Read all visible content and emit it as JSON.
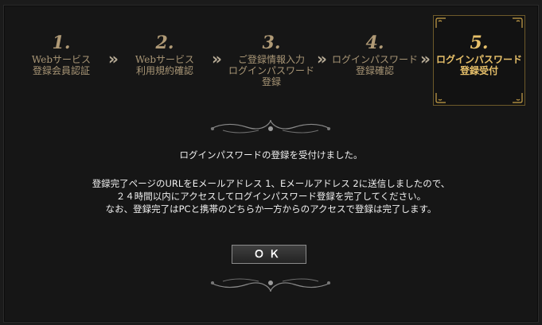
{
  "steps": [
    {
      "num": "1.",
      "label": "Webサービス\n登録会員認証"
    },
    {
      "num": "2.",
      "label": "Webサービス\n利用規約確認"
    },
    {
      "num": "3.",
      "label": "ご登録情報入力\nログインパスワード\n登録"
    },
    {
      "num": "4.",
      "label": "ログインパスワード\n登録確認"
    },
    {
      "num": "5.",
      "label": "ログインパスワード\n登録受付"
    }
  ],
  "arrow_glyph": "»",
  "message": {
    "line1": "ログインパスワードの登録を受付けました。",
    "line2": "登録完了ページのURLをEメールアドレス 1、Eメールアドレス 2に送信しましたので、",
    "line3": "２４時間以内にアクセスしてログインパスワード登録を完了してください。",
    "line4": "なお、登録完了はPCと携帯のどちらか一方からのアクセスで登録は完了します。"
  },
  "ok_label": "ＯＫ",
  "colors": {
    "gold": "#e7c06a",
    "muted_gold": "#a99676",
    "background": "#161616"
  }
}
